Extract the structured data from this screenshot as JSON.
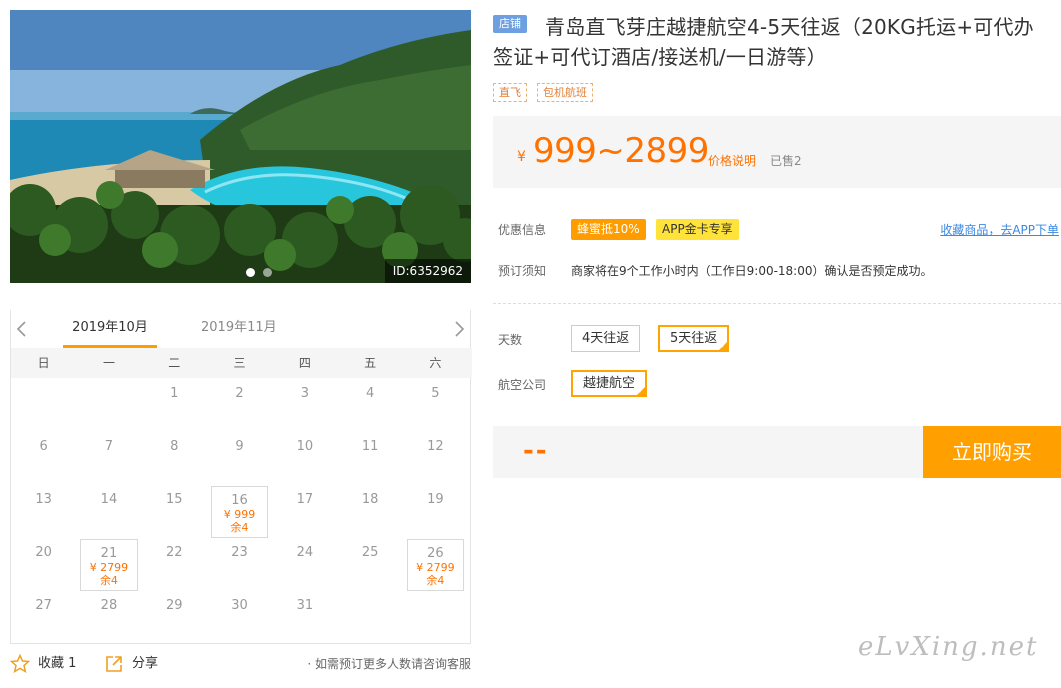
{
  "photo": {
    "id_label": "ID:6352962",
    "dots": 2,
    "active_dot": 0
  },
  "calendar": {
    "months": [
      "2019年10月",
      "2019年11月"
    ],
    "active_month": 0,
    "weekdays": [
      "日",
      "一",
      "二",
      "三",
      "四",
      "五",
      "六"
    ],
    "weeks": [
      [
        {
          "day": ""
        },
        {
          "day": ""
        },
        {
          "day": "1"
        },
        {
          "day": "2"
        },
        {
          "day": "3"
        },
        {
          "day": "4"
        },
        {
          "day": "5"
        }
      ],
      [
        {
          "day": "6"
        },
        {
          "day": "7"
        },
        {
          "day": "8"
        },
        {
          "day": "9"
        },
        {
          "day": "10"
        },
        {
          "day": "11"
        },
        {
          "day": "12"
        }
      ],
      [
        {
          "day": "13"
        },
        {
          "day": "14"
        },
        {
          "day": "15"
        },
        {
          "day": "16",
          "price": "¥ 999",
          "stock": "余4"
        },
        {
          "day": "17"
        },
        {
          "day": "18"
        },
        {
          "day": "19"
        }
      ],
      [
        {
          "day": "20"
        },
        {
          "day": "21",
          "price": "¥ 2799",
          "stock": "余4"
        },
        {
          "day": "22"
        },
        {
          "day": "23"
        },
        {
          "day": "24"
        },
        {
          "day": "25"
        },
        {
          "day": "26",
          "price": "¥ 2799",
          "stock": "余4"
        }
      ],
      [
        {
          "day": "27"
        },
        {
          "day": "28"
        },
        {
          "day": "29"
        },
        {
          "day": "30"
        },
        {
          "day": "31"
        },
        {
          "day": ""
        },
        {
          "day": ""
        }
      ]
    ]
  },
  "actions": {
    "favorite_label": "收藏 1",
    "share_label": "分享",
    "consult_text": "· 如需预订更多人数请咨询客服"
  },
  "product": {
    "shop_tag": "店铺",
    "title": "青岛直飞芽庄越捷航空4-5天往返（20KG托运+可代办签证+可代订酒店/接送机/一日游等）",
    "labels": [
      "直飞",
      "包机航班"
    ],
    "price_currency": "¥",
    "price_range": "999~2899",
    "price_note": "价格说明",
    "sold": "已售2"
  },
  "promo": {
    "label": "优惠信息",
    "badge_honey": "蜂蜜抵10%",
    "badge_app": "APP金卡专享",
    "app_link": "收藏商品，去APP下单"
  },
  "booking_notice": {
    "label": "预订须知",
    "text": "商家将在9个工作小时内（工作日9:00-18:00）确认是否预定成功。"
  },
  "options": {
    "days_label": "天数",
    "days": [
      "4天往返",
      "5天往返"
    ],
    "days_selected": 1,
    "airline_label": "航空公司",
    "airlines": [
      "越捷航空"
    ],
    "airline_selected": 0
  },
  "buy": {
    "price_placeholder": "--",
    "button_label": "立即购买"
  },
  "watermark": "eLvXing.net",
  "colors": {
    "accent": "#ff7200",
    "buy_button": "#ffa000",
    "selected_border": "#ffa400",
    "link": "#3b89e0"
  }
}
